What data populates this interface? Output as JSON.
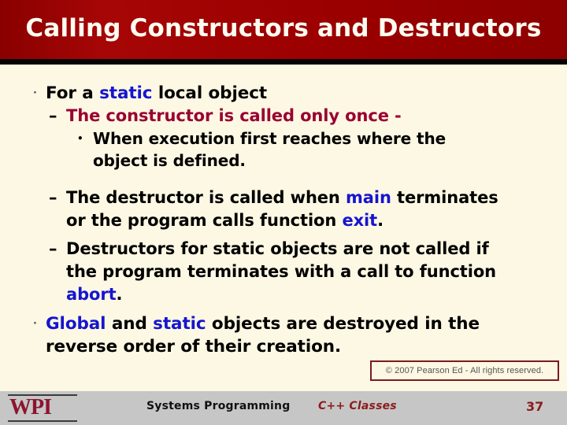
{
  "slide": {
    "title": "Calling Constructors and Destructors",
    "colors": {
      "title_bar": "#9b0000",
      "title_text": "#fffdf2",
      "body_background": "#fdf8e3",
      "keyword_blue": "#1515cf",
      "crimson": "#990033",
      "footer_band": "#c6c6c6",
      "wpi_maroon": "#8c1430",
      "separator_black": "#040404"
    }
  },
  "body": {
    "bullet_glyph": "·",
    "dash_glyph": "–",
    "dot_glyph": "•",
    "b1": {
      "pre": "For a ",
      "kw": "static",
      "post": " local object"
    },
    "b1s1": {
      "text": "The constructor is called only once -"
    },
    "b1s1a": {
      "line1": "When  execution  first  reaches  where  the",
      "line2": "object is defined."
    },
    "b1s2": {
      "l1_pre": "The destructor is called when ",
      "l1_kw": "main",
      "l1_post": " terminates",
      "l2_pre": "or the program calls function ",
      "l2_kw": "exit",
      "l2_post": "."
    },
    "b1s3": {
      "line1": "Destructors for static objects are not called if",
      "line2": "the program terminates with a call to function",
      "l3_kw": "abort",
      "l3_post": "."
    },
    "b2": {
      "kw1": "Global",
      "mid": " and ",
      "kw2": "static",
      "l1_post": " objects  are  destroyed  in  the",
      "line2": "reverse order of their creation."
    }
  },
  "copyright": {
    "text": "© 2007 Pearson Ed - All rights reserved."
  },
  "footer": {
    "logo_text": "WPI",
    "course": "Systems Programming",
    "topic": "C++ Classes",
    "page_number": "37"
  }
}
